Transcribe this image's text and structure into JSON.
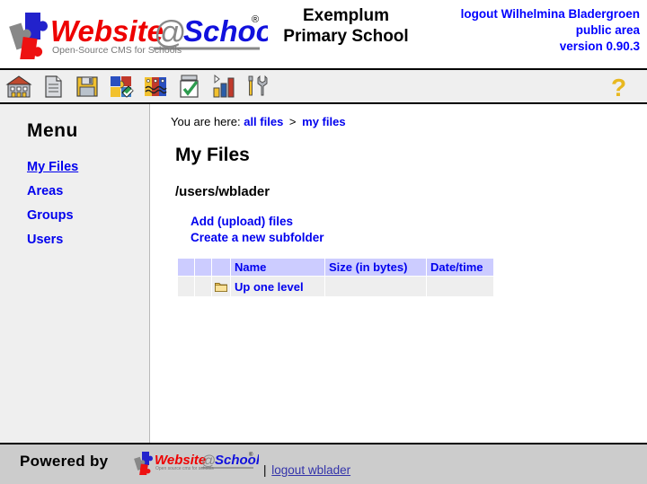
{
  "header": {
    "logo_text": "Website@School",
    "logo_registered_mark": "®",
    "logo_tagline": "Open-Source CMS for Schools",
    "school_name_line1": "Exemplum",
    "school_name_line2": "Primary School",
    "logout_label": "logout Wilhelmina Bladergroen",
    "area_label": "public area",
    "version_label": "version 0.90.3"
  },
  "toolbar": {
    "icons": [
      {
        "name": "school-building-icon",
        "title": "Home"
      },
      {
        "name": "page-document-icon",
        "title": "Pages"
      },
      {
        "name": "floppy-save-icon",
        "title": "Save"
      },
      {
        "name": "puzzle-modules-icon",
        "title": "Modules"
      },
      {
        "name": "users-faces-icon",
        "title": "Users"
      },
      {
        "name": "checklist-icon",
        "title": "Tasks"
      },
      {
        "name": "bar-chart-icon",
        "title": "Statistics"
      },
      {
        "name": "tools-icon",
        "title": "Tools"
      }
    ],
    "help_icon": "question-mark-help-icon",
    "help_glyph": "?"
  },
  "sidebar": {
    "title": "Menu",
    "items": [
      {
        "label": "My Files",
        "active": true
      },
      {
        "label": "Areas",
        "active": false
      },
      {
        "label": "Groups",
        "active": false
      },
      {
        "label": "Users",
        "active": false
      }
    ]
  },
  "content": {
    "breadcrumb": {
      "prefix": "You are here:",
      "first": "all files",
      "separator": ">",
      "second": "my files"
    },
    "page_title": "My Files",
    "path": "/users/wblader",
    "actions": [
      {
        "label": "Add (upload) files"
      },
      {
        "label": "Create a new subfolder"
      }
    ],
    "table": {
      "headers": [
        "",
        "",
        "",
        "Name",
        "Size (in bytes)",
        "Date/time"
      ],
      "rows": [
        {
          "col1": "",
          "col2": "",
          "icon": "folder-icon",
          "name": "Up one level",
          "size": "",
          "datetime": ""
        }
      ]
    }
  },
  "footer": {
    "powered_by": "Powered by",
    "logo_text": "Website@School",
    "logo_registered_mark": "®",
    "logo_tagline": "Open source cms for schools",
    "separator": "|",
    "logout_label": "logout wblader"
  },
  "colors": {
    "link_blue": "#0000ee",
    "accent_blue": "#0000ff",
    "table_header_bg": "#ccccff",
    "table_row_bg": "#eeeeee",
    "toolbar_bg": "#efefef",
    "sidebar_bg": "#efefef",
    "footer_bg": "#cccccc",
    "logo_red": "#ee0000",
    "logo_blue": "#1111dd",
    "help_gold": "#e8b820"
  }
}
